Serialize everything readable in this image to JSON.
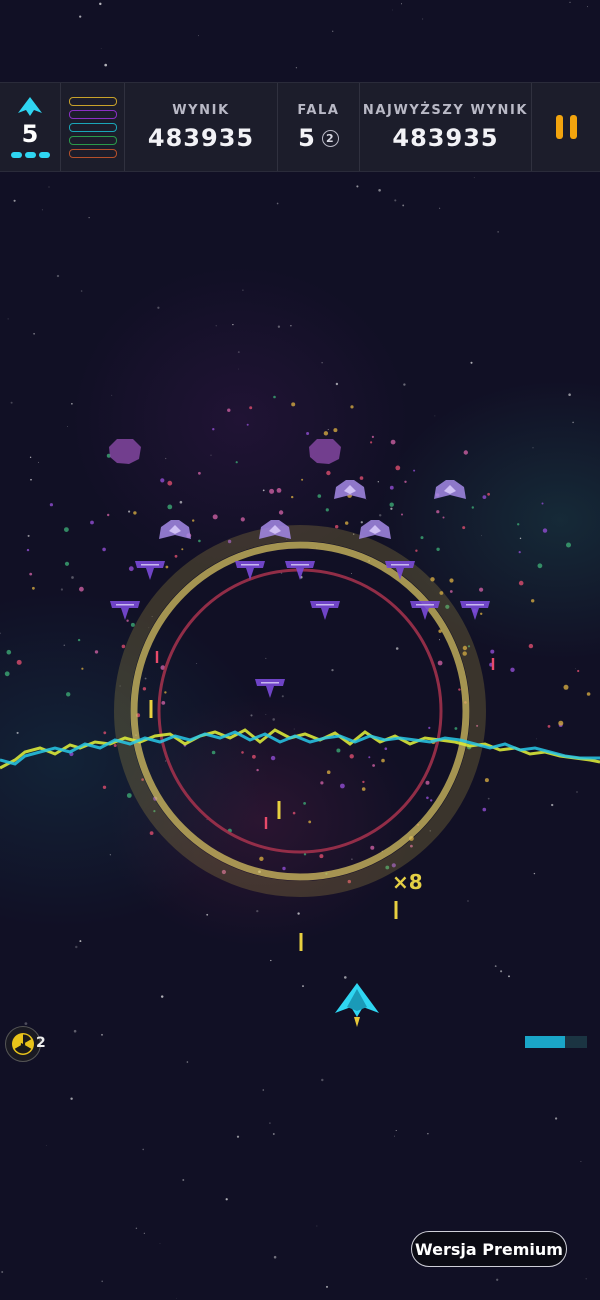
{
  "hud": {
    "lives": "5",
    "score_label": "WYNIK",
    "score": "483935",
    "wave_label": "FALA",
    "wave": "5",
    "wave_sub": "2",
    "high_label": "NAJWYŻSZY WYNIK",
    "high_score": "483935",
    "weapon_bar_colors": [
      "#c8a22a",
      "#8a2fc4",
      "#1aa6b8",
      "#2a9a4a",
      "#b5502a"
    ]
  },
  "combo": "×8",
  "bombs": {
    "count": "2"
  },
  "energy": {
    "level": 0.65
  },
  "premium_button": "Wersja Premium",
  "colors": {
    "accent": "#2fd6f2",
    "pause": "#f2a40e",
    "ring_outer": "#d6c060",
    "ring_inner": "#a8324e",
    "enemy": "#7a4ad8",
    "enemy_light": "#a58ae6"
  }
}
